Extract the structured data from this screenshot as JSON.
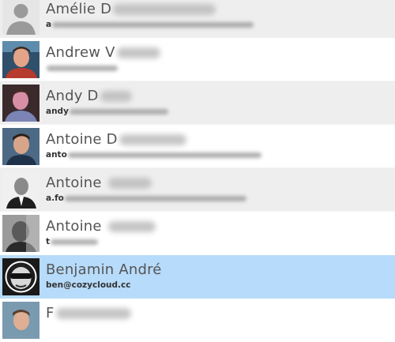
{
  "contacts": [
    {
      "name": "Amélie D",
      "email": "a",
      "avatar": "default-avatar",
      "style": "alt"
    },
    {
      "name": "Andrew V",
      "email": "",
      "avatar": "photo-man-red-shirt",
      "style": "plain"
    },
    {
      "name": "Andy D",
      "email": "andy",
      "avatar": "photo-man-pink",
      "style": "alt"
    },
    {
      "name": "Antoine D",
      "email": "anto",
      "avatar": "photo-man-blue",
      "style": "plain"
    },
    {
      "name": "Antoine",
      "email": "a.fo",
      "avatar": "photo-man-suit",
      "style": "alt"
    },
    {
      "name": "Antoine",
      "email": "t",
      "avatar": "photo-man-grayscale",
      "style": "plain"
    },
    {
      "name": "Benjamin André",
      "email": "ben@cozycloud.cc",
      "avatar": "photo-man-sunglasses",
      "style": "selected"
    },
    {
      "name": "F",
      "email": "",
      "avatar": "photo-man-partial",
      "style": "plain"
    }
  ],
  "colors": {
    "selected_row": "#b7dbfa",
    "alt_row": "#eeeeee",
    "name_text": "#555555",
    "email_text": "#333333"
  }
}
